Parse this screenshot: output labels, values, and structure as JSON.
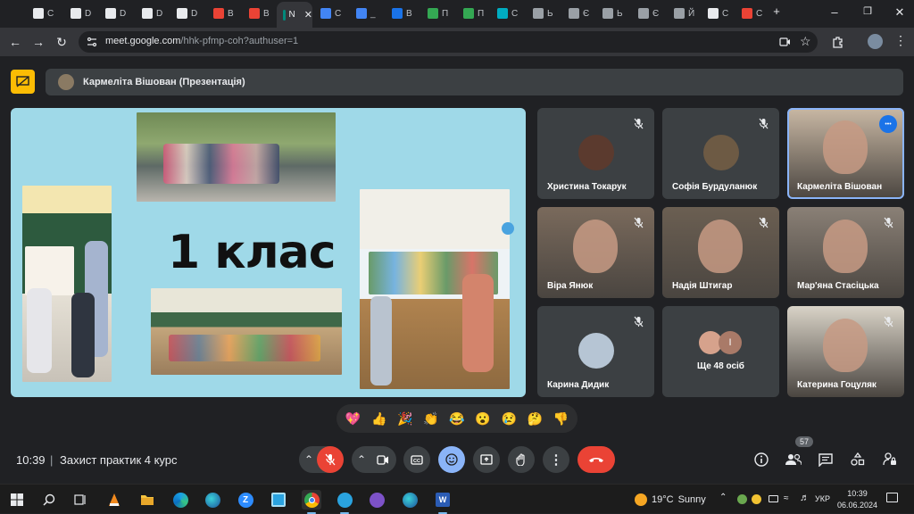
{
  "browser": {
    "tabs": [
      {
        "label": "C",
        "color": "#e8eaed"
      },
      {
        "label": "D",
        "color": "#e8eaed"
      },
      {
        "label": "D",
        "color": "#e8eaed"
      },
      {
        "label": "D",
        "color": "#e8eaed"
      },
      {
        "label": "D",
        "color": "#e8eaed"
      },
      {
        "label": "B",
        "color": "#ea4335"
      },
      {
        "label": "B",
        "color": "#ea4335"
      },
      {
        "label": "N",
        "color": "#00897b"
      },
      {
        "label": "C",
        "color": "#4285f4"
      },
      {
        "label": "_",
        "color": "#4285f4"
      },
      {
        "label": "B",
        "color": "#1a73e8"
      },
      {
        "label": "П",
        "color": "#34a853"
      },
      {
        "label": "П",
        "color": "#34a853"
      },
      {
        "label": "C",
        "color": "#00acc1"
      },
      {
        "label": "Ь",
        "color": "#9aa0a6"
      },
      {
        "label": "Є",
        "color": "#9aa0a6"
      },
      {
        "label": "Ь",
        "color": "#9aa0a6"
      },
      {
        "label": "Є",
        "color": "#9aa0a6"
      },
      {
        "label": "Й",
        "color": "#9aa0a6"
      },
      {
        "label": "C",
        "color": "#e8eaed"
      },
      {
        "label": "C",
        "color": "#ea4335"
      }
    ],
    "new_tab": "+",
    "url_host": "meet.google.com",
    "url_path": "/hhk-pfmp-coh?authuser=1"
  },
  "meet": {
    "presenter_banner": "Кармеліта Вішован (Презентація)",
    "slide_title": "1 клас",
    "participants": [
      {
        "name": "Христина Токарук",
        "type": "avatar",
        "color": "#5b3a2e"
      },
      {
        "name": "Софія Бурдуланюк",
        "type": "avatar",
        "color": "#6d5a44"
      },
      {
        "name": "Кармеліта Вішован",
        "type": "video",
        "color": "#c9b8a4"
      },
      {
        "name": "Віра Янюк",
        "type": "video",
        "color": "#7a6a5c"
      },
      {
        "name": "Надія Штигар",
        "type": "video",
        "color": "#6b5f52"
      },
      {
        "name": "Мар'яна Стасіцька",
        "type": "video",
        "color": "#8a8076"
      },
      {
        "name": "Карина Дидик",
        "type": "avatar",
        "color": "#b6c5d4"
      },
      {
        "name": "Ще 48 осіб",
        "type": "more",
        "color": "#3c4043"
      },
      {
        "name": "Катерина Гоцуляк",
        "type": "video",
        "color": "#d9d3c7"
      }
    ],
    "more_avatar_letter": "І",
    "reactions": [
      "💖",
      "👍",
      "🎉",
      "👏",
      "😂",
      "😮",
      "😢",
      "🤔",
      "👎"
    ],
    "time": "10:39",
    "separator": "|",
    "meeting_title": "Захист практик 4 курс",
    "people_count": "57"
  },
  "taskbar": {
    "weather_temp": "19°C",
    "weather_desc": "Sunny",
    "language": "УКР",
    "clock_time": "10:39",
    "clock_date": "06.06.2024"
  }
}
